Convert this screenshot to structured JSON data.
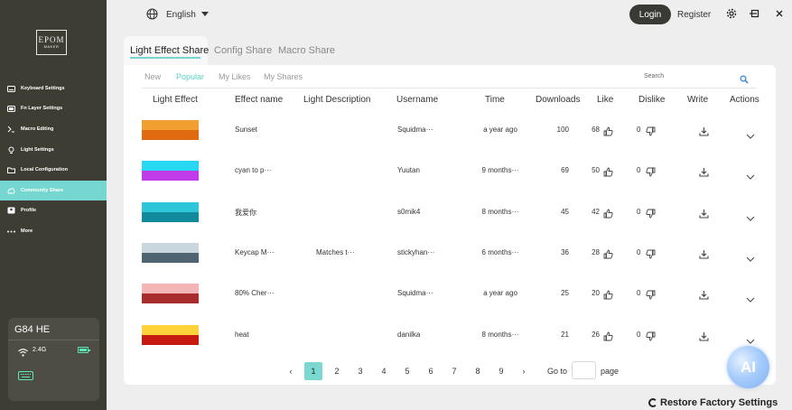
{
  "brand": {
    "logo_line1": "EPOM",
    "logo_line2": "MAKER"
  },
  "sidebar": {
    "items": [
      {
        "label": "Keyboard Settings",
        "icon": "keyboard-icon"
      },
      {
        "label": "Fn Layer Settings",
        "icon": "fn-layer-icon"
      },
      {
        "label": "Macro Editing",
        "icon": "macro-icon"
      },
      {
        "label": "Light Settings",
        "icon": "light-icon"
      },
      {
        "label": "Local Configuration",
        "icon": "folder-icon"
      },
      {
        "label": "Community Share",
        "icon": "community-icon",
        "active": true
      },
      {
        "label": "Profile",
        "icon": "profile-icon"
      },
      {
        "label": "More",
        "icon": "more-icon"
      }
    ],
    "accent": "#76d7d0"
  },
  "device": {
    "name": "G84 HE",
    "frequency": "2.4G",
    "battery": 0.75
  },
  "topbar": {
    "language": "English",
    "login": "Login",
    "register": "Register"
  },
  "tabs": [
    {
      "label": "Light Effect Share",
      "active": true
    },
    {
      "label": "Config Share"
    },
    {
      "label": "Macro Share"
    }
  ],
  "filters": [
    {
      "label": "New"
    },
    {
      "label": "Popular",
      "active": true
    },
    {
      "label": "My Likes"
    },
    {
      "label": "My Shares"
    }
  ],
  "search": {
    "label": "Search"
  },
  "table": {
    "headers": [
      "Light Effect",
      "Effect name",
      "Light Description",
      "Username",
      "Time",
      "Downloads",
      "Like",
      "Dislike",
      "Write",
      "Actions"
    ],
    "rows": [
      {
        "effect_name": "Sunset",
        "description": "",
        "username": "Squidma···",
        "time": "a year ago",
        "downloads": "100",
        "likes": "68",
        "dislikes": "0",
        "colors": [
          "#f0a030",
          "#e06a10"
        ]
      },
      {
        "effect_name": "cyan to p···",
        "description": "",
        "username": "Yuutan",
        "time": "9 months···",
        "downloads": "69",
        "likes": "50",
        "dislikes": "0",
        "colors": [
          "#27d6f0",
          "#c03ce8"
        ]
      },
      {
        "effect_name": "我爱你",
        "description": "",
        "username": "s0mik4",
        "time": "8 months···",
        "downloads": "45",
        "likes": "42",
        "dislikes": "0",
        "colors": [
          "#2cc6d8",
          "#108a9c"
        ]
      },
      {
        "effect_name": "Keycap M···",
        "description": "Matches t···",
        "username": "stickyhan···",
        "time": "6 months···",
        "downloads": "36",
        "likes": "28",
        "dislikes": "0",
        "colors": [
          "#c9d6de",
          "#4e6470"
        ]
      },
      {
        "effect_name": "80% Cher···",
        "description": "",
        "username": "Squidma···",
        "time": "a year ago",
        "downloads": "25",
        "likes": "20",
        "dislikes": "0",
        "colors": [
          "#f3b5b5",
          "#a92c2c"
        ]
      },
      {
        "effect_name": "heat",
        "description": "",
        "username": "danilka",
        "time": "8 months···",
        "downloads": "21",
        "likes": "26",
        "dislikes": "0",
        "colors": [
          "#ffd23a",
          "#c61a0e"
        ]
      }
    ]
  },
  "pagination": {
    "pages": [
      "1",
      "2",
      "3",
      "4",
      "5",
      "6",
      "7",
      "8",
      "9"
    ],
    "current": "1",
    "goto_label": "Go to",
    "page_label": "page"
  },
  "footer": {
    "restore": "Restore Factory Settings"
  },
  "ai_badge": {
    "label": "AI"
  }
}
